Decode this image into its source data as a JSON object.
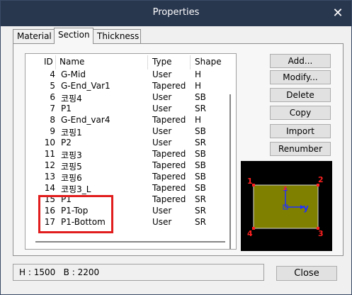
{
  "window": {
    "title": "Properties",
    "close_glyph": "✕"
  },
  "tabs": [
    {
      "label": "Material"
    },
    {
      "label": "Section"
    },
    {
      "label": "Thickness"
    }
  ],
  "table": {
    "columns": {
      "id": "ID",
      "name": "Name",
      "type": "Type",
      "shape": "Shape"
    },
    "rows": [
      {
        "id": "4",
        "name": "G-Mid",
        "type": "User",
        "shape": "H"
      },
      {
        "id": "5",
        "name": "G-End_Var1",
        "type": "Tapered",
        "shape": "H"
      },
      {
        "id": "6",
        "name": "코핑4",
        "type": "User",
        "shape": "SB"
      },
      {
        "id": "7",
        "name": "P1",
        "type": "User",
        "shape": "SR"
      },
      {
        "id": "8",
        "name": "G-End_var4",
        "type": "Tapered",
        "shape": "H"
      },
      {
        "id": "9",
        "name": "코핑1",
        "type": "User",
        "shape": "SB"
      },
      {
        "id": "10",
        "name": "P2",
        "type": "User",
        "shape": "SR"
      },
      {
        "id": "11",
        "name": "코핑3",
        "type": "Tapered",
        "shape": "SB"
      },
      {
        "id": "12",
        "name": "코핑5",
        "type": "Tapered",
        "shape": "SB"
      },
      {
        "id": "13",
        "name": "코핑6",
        "type": "Tapered",
        "shape": "SB"
      },
      {
        "id": "14",
        "name": "코핑3_L",
        "type": "Tapered",
        "shape": "SB"
      },
      {
        "id": "15",
        "name": "P1",
        "type": "Tapered",
        "shape": "SR"
      },
      {
        "id": "16",
        "name": "P1-Top",
        "type": "User",
        "shape": "SR"
      },
      {
        "id": "17",
        "name": "P1-Bottom",
        "type": "User",
        "shape": "SR"
      }
    ]
  },
  "buttons": {
    "add": "Add...",
    "modify": "Modify...",
    "delete": "Delete",
    "copy": "Copy",
    "import": "Import",
    "renumber": "Renumber",
    "close": "Close"
  },
  "preview": {
    "corner_labels": [
      "1",
      "2",
      "3",
      "4"
    ],
    "axis_z": "z",
    "axis_y": "y",
    "fill_color": "#808000",
    "corner_color": "#ff2020",
    "axis_color": "#2030ff"
  },
  "status": {
    "text": "H : 1500   B : 2200"
  },
  "highlight_color": "#e21d1d"
}
